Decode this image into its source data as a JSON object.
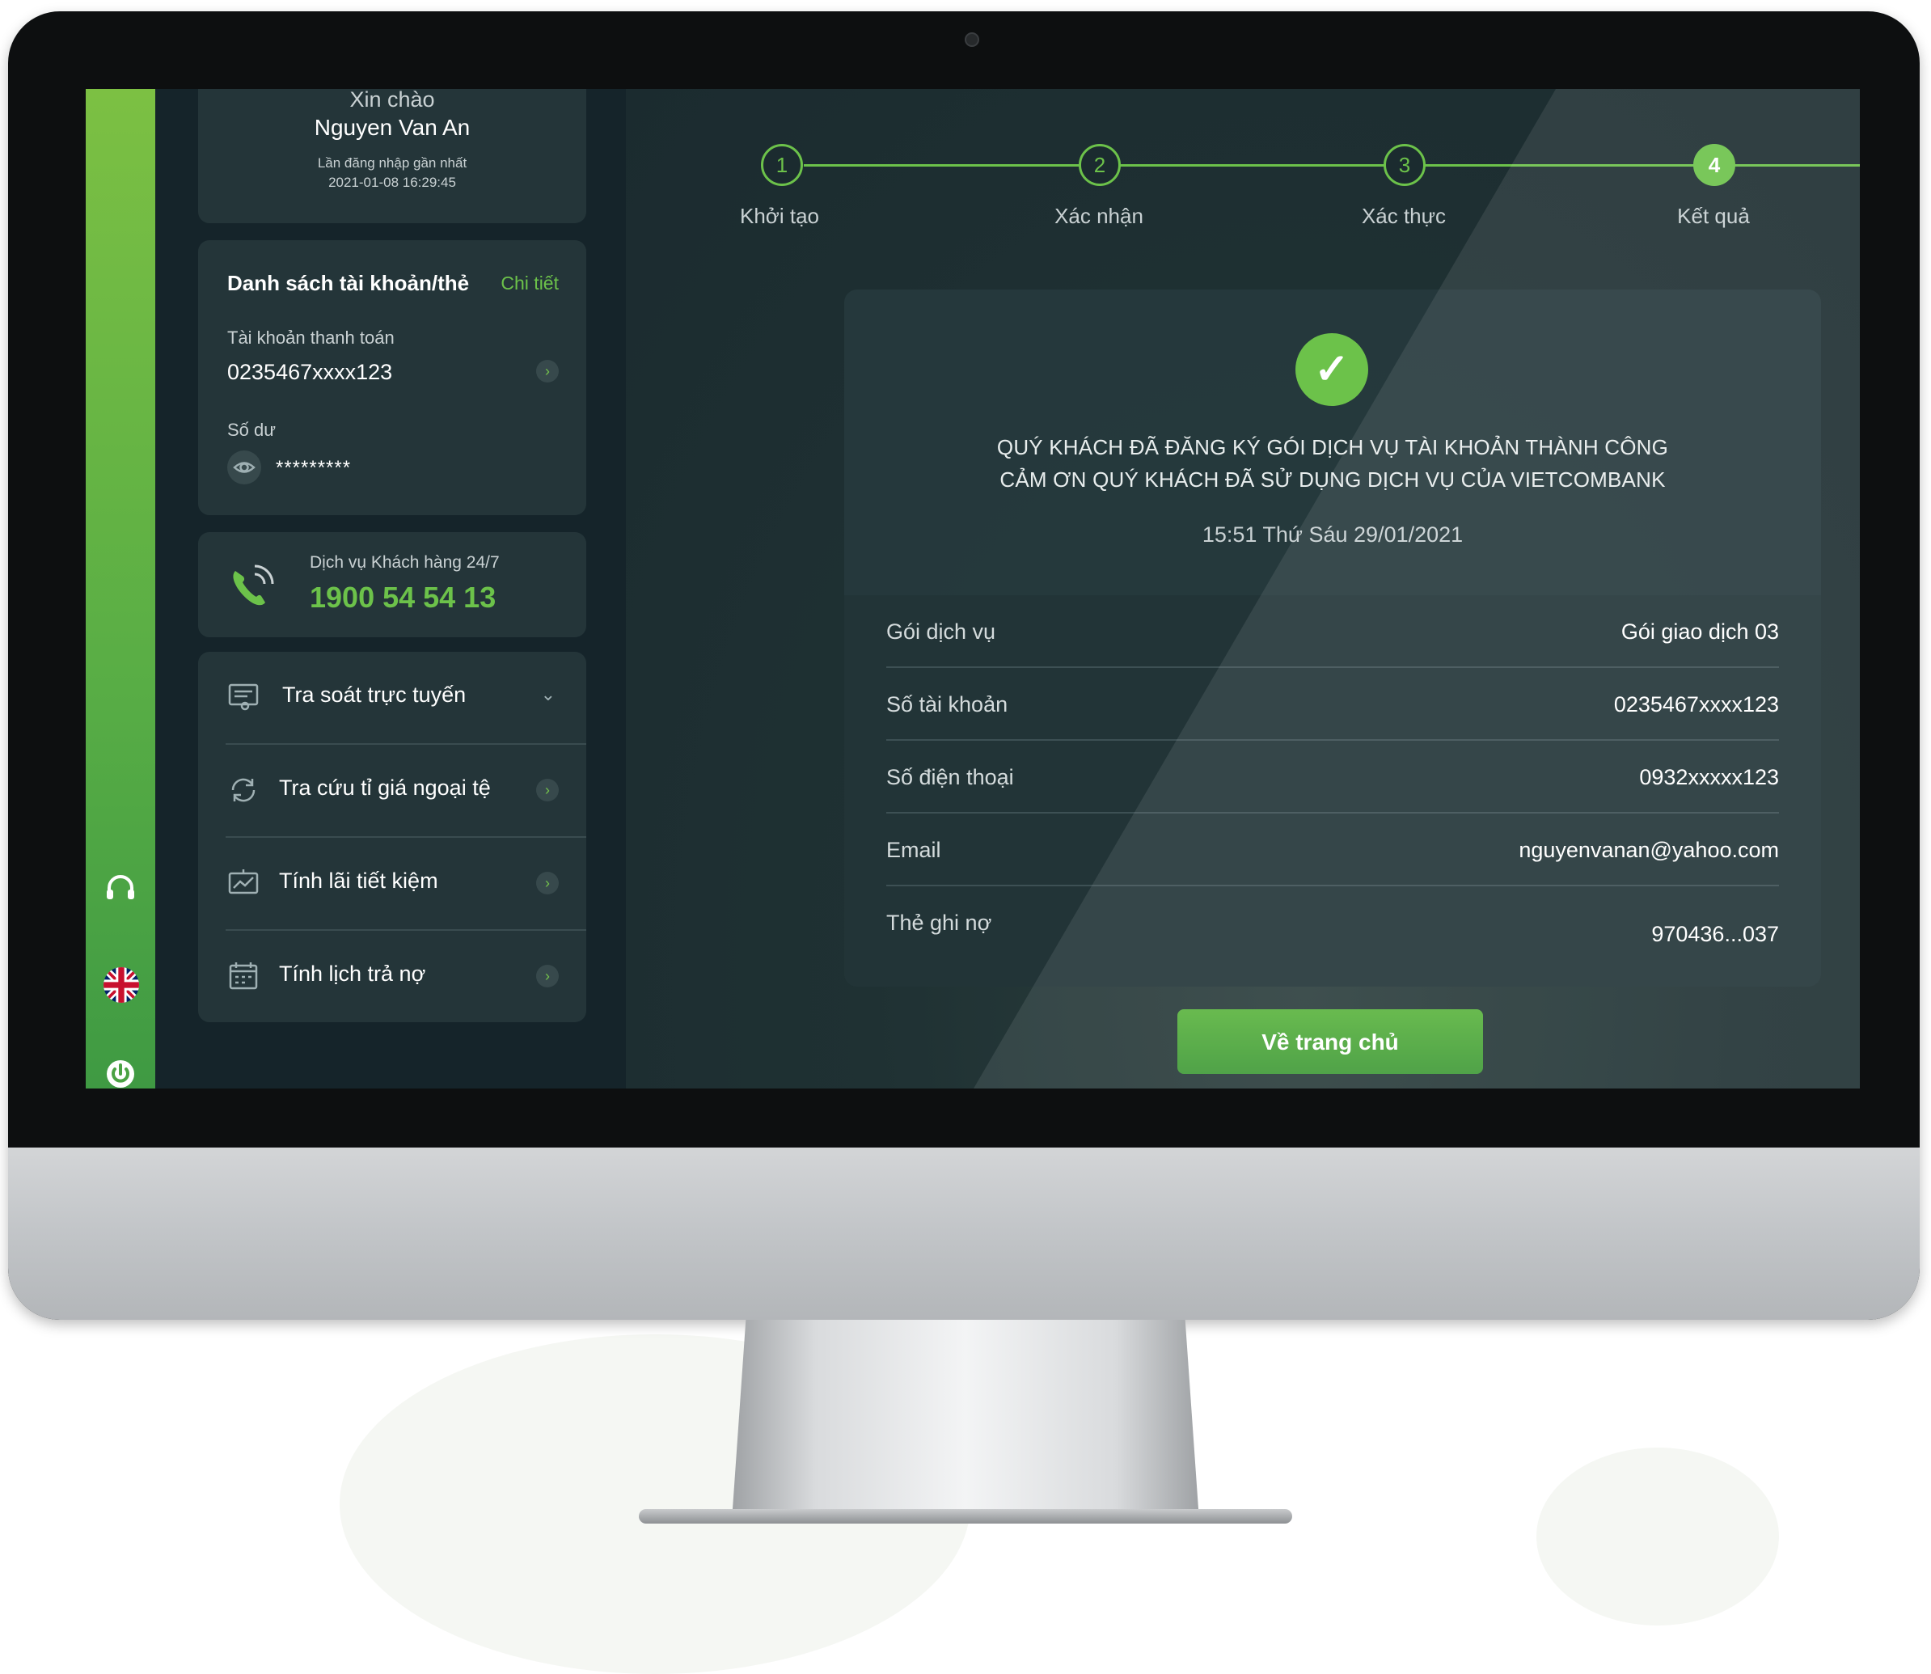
{
  "sidebar": {
    "greeting": "Xin chào",
    "user_name": "Nguyen Van An",
    "last_login_label": "Lần đăng nhập gần nhất",
    "last_login_time": "2021-01-08 16:29:45",
    "accounts": {
      "title": "Danh sách tài khoản/thẻ",
      "detail_link": "Chi tiết",
      "account_type": "Tài khoản thanh toán",
      "account_number": "0235467xxxx123",
      "balance_label": "Số dư",
      "balance_masked": "*********"
    },
    "hotline": {
      "label": "Dịch vụ Khách hàng 24/7",
      "number": "1900 54 54 13"
    },
    "menu": [
      {
        "label": "Tra soát trực tuyến",
        "icon": "document-search-icon"
      },
      {
        "label": "Tra cứu tỉ giá ngoại tệ",
        "icon": "exchange-icon"
      },
      {
        "label": "Tính lãi tiết kiệm",
        "icon": "chart-icon"
      },
      {
        "label": "Tính lịch trả nợ",
        "icon": "calendar-icon"
      }
    ]
  },
  "steps": [
    {
      "number": "1",
      "label": "Khởi tạo"
    },
    {
      "number": "2",
      "label": "Xác nhận"
    },
    {
      "number": "3",
      "label": "Xác thực"
    },
    {
      "number": "4",
      "label": "Kết quả"
    }
  ],
  "result": {
    "message_line1": "QUÝ KHÁCH ĐÃ ĐĂNG KÝ GÓI DỊCH VỤ TÀI KHOẢN THÀNH CÔNG",
    "message_line2": "CẢM ƠN QUÝ KHÁCH ĐÃ SỬ DỤNG DỊCH VỤ CỦA VIETCOMBANK",
    "timestamp": "15:51 Thứ Sáu 29/01/2021",
    "details": [
      {
        "label": "Gói dịch vụ",
        "value": "Gói giao dịch 03"
      },
      {
        "label": "Số tài khoản",
        "value": "0235467xxxx123"
      },
      {
        "label": "Số điện thoại",
        "value": "0932xxxxx123"
      },
      {
        "label": "Email",
        "value": "nguyenvanan@yahoo.com"
      },
      {
        "label": "Thẻ ghi nợ",
        "value": "970436...037"
      }
    ],
    "home_button": "Về trang chủ"
  },
  "colors": {
    "accent": "#6cc24a",
    "rail": "#58ad45",
    "panel": "#243539",
    "background": "#18262b"
  }
}
